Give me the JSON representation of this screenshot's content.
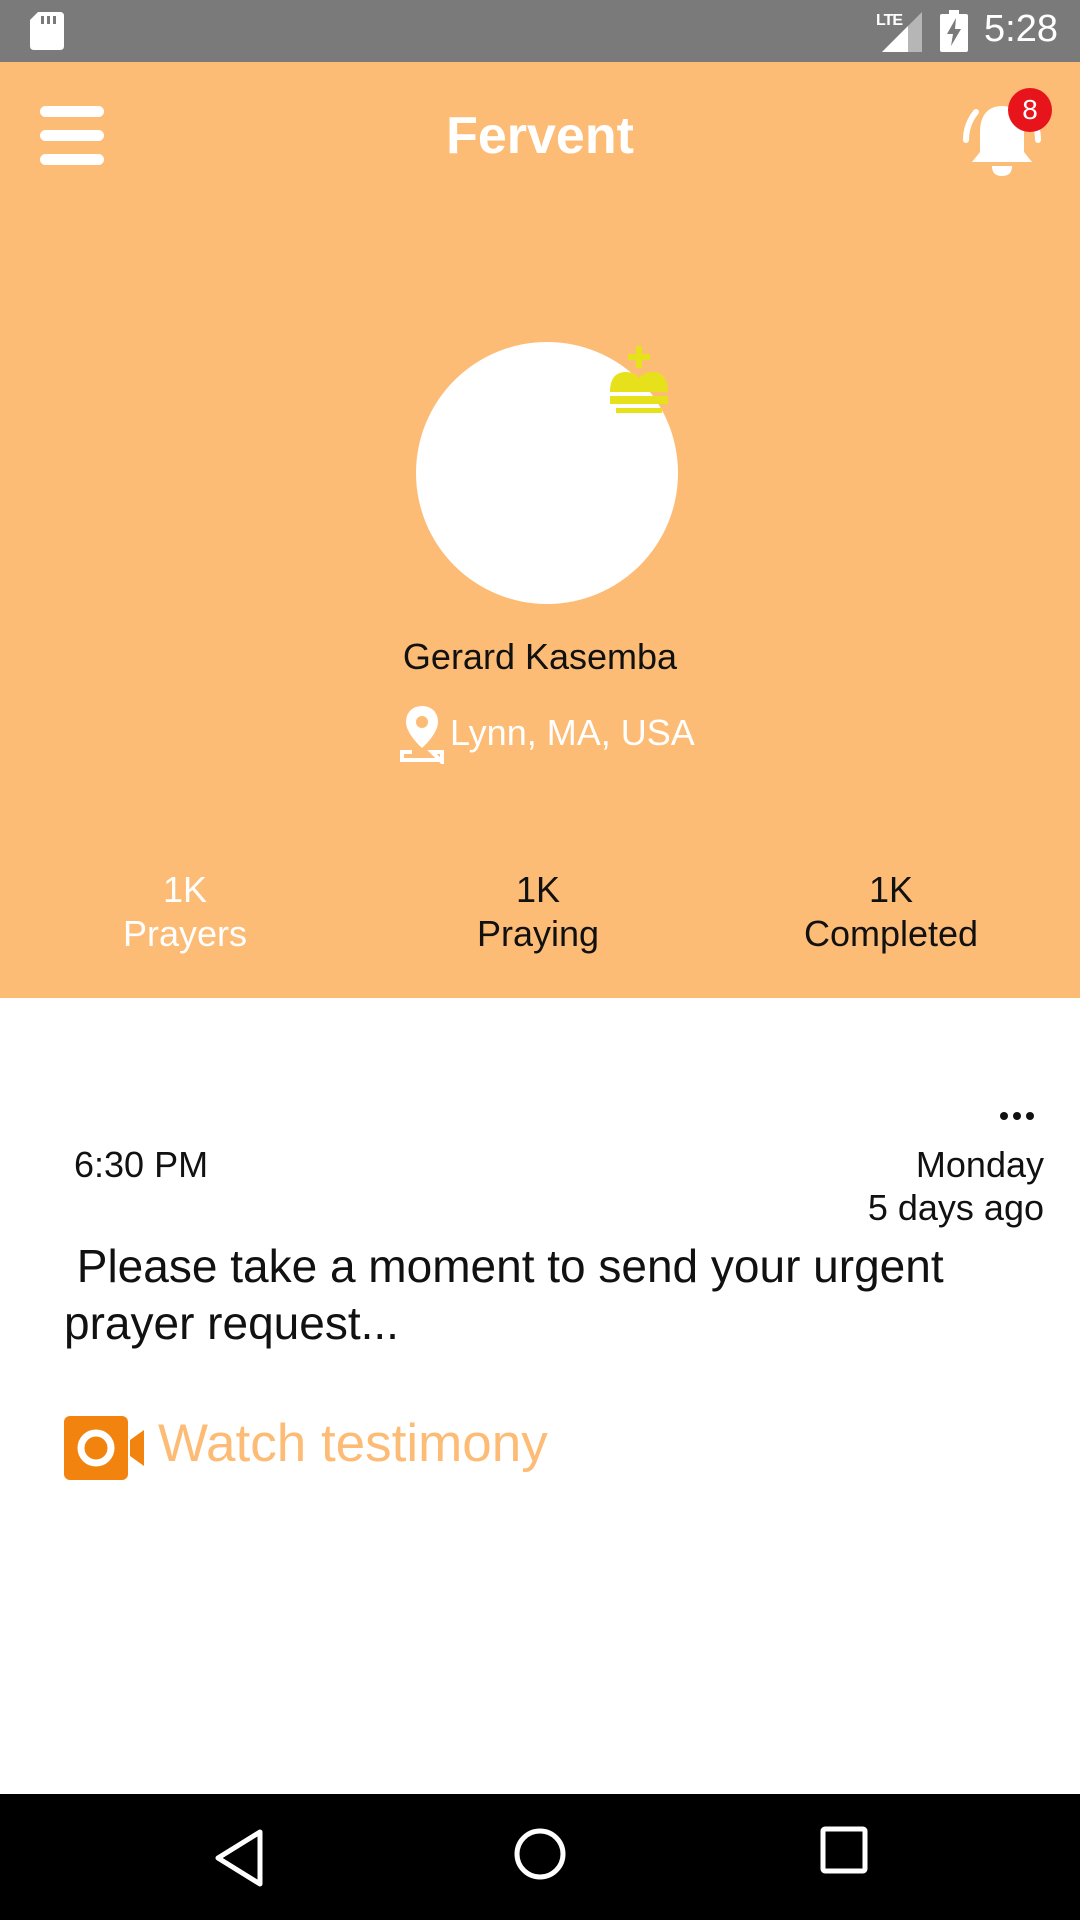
{
  "status_bar": {
    "network": "LTE",
    "time": "5:28"
  },
  "header": {
    "title": "Fervent",
    "notification_count": "8"
  },
  "profile": {
    "name": "Gerard Kasemba",
    "location": "Lynn, MA, USA"
  },
  "stats": [
    {
      "value": "1K",
      "label": "Prayers"
    },
    {
      "value": "1K",
      "label": "Praying"
    },
    {
      "value": "1K",
      "label": "Completed"
    }
  ],
  "post": {
    "time": "6:30 PM",
    "day": "Monday",
    "ago": "5 days ago",
    "message": " Please take a moment to send your urgent prayer request...",
    "link_label": "Watch testimony"
  },
  "colors": {
    "header_bg": "#fdbc76",
    "badge": "#e8141b",
    "crown": "#e6e11a",
    "video_icon": "#f2830f",
    "status_bar": "#7a7a7a"
  },
  "icons": [
    "sd-card-icon",
    "signal-icon",
    "battery-charging-icon",
    "menu-icon",
    "bell-icon",
    "crown-cross-icon",
    "location-pin-icon",
    "more-horizontal-icon",
    "video-camera-icon",
    "back-icon",
    "home-icon",
    "recents-icon"
  ]
}
